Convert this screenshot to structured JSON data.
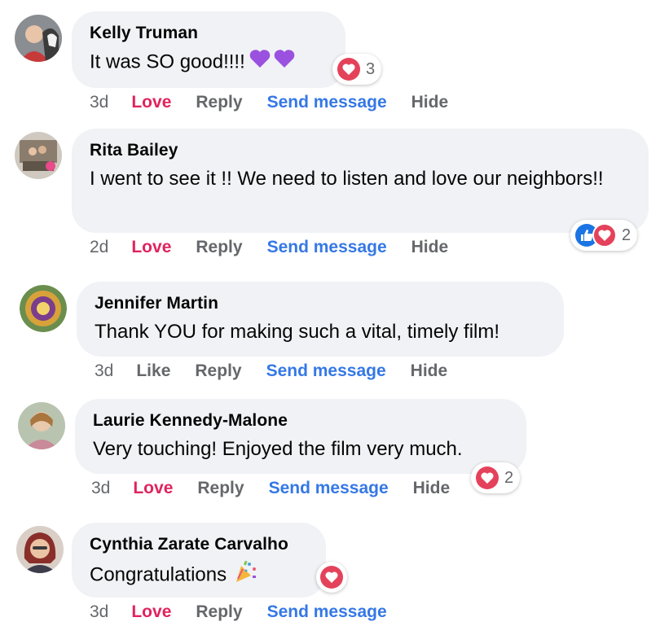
{
  "colors": {
    "love": "#e0245e",
    "send": "#3578e5",
    "bubble": "#f0f2f5",
    "muted": "#65676b"
  },
  "comments": [
    {
      "author": "Kelly Truman",
      "text": "It was SO good!!!!",
      "emoji": [
        "purple-heart-icon",
        "purple-heart-icon"
      ],
      "reactions": {
        "icons": [
          "heart-reaction-icon"
        ],
        "count": "3"
      },
      "time": "3d",
      "reaction_label": "Love",
      "reply": "Reply",
      "send": "Send message",
      "hide": "Hide"
    },
    {
      "author": "Rita Bailey",
      "text": "I went to see it !! We need to listen and love our neighbors!!",
      "reactions": {
        "icons": [
          "like-reaction-icon",
          "heart-reaction-icon"
        ],
        "count": "2"
      },
      "time": "2d",
      "reaction_label": "Love",
      "reply": "Reply",
      "send": "Send message",
      "hide": "Hide"
    },
    {
      "author": "Jennifer Martin",
      "text": "Thank YOU for making such a vital, timely film!",
      "time": "3d",
      "reaction_label": "Like",
      "reply": "Reply",
      "send": "Send message",
      "hide": "Hide"
    },
    {
      "author": "Laurie Kennedy-Malone",
      "text": "Very touching! Enjoyed the film very much.",
      "reactions": {
        "icons": [
          "heart-reaction-icon"
        ],
        "count": "2"
      },
      "time": "3d",
      "reaction_label": "Love",
      "reply": "Reply",
      "send": "Send message",
      "hide": "Hide"
    },
    {
      "author": "Cynthia Zarate Carvalho",
      "text": "Congratulations",
      "emoji": [
        "confetti-icon"
      ],
      "reactions": {
        "icons": [
          "heart-reaction-icon"
        ]
      },
      "time": "3d",
      "reaction_label": "Love",
      "reply": "Reply",
      "send": "Send message"
    }
  ]
}
